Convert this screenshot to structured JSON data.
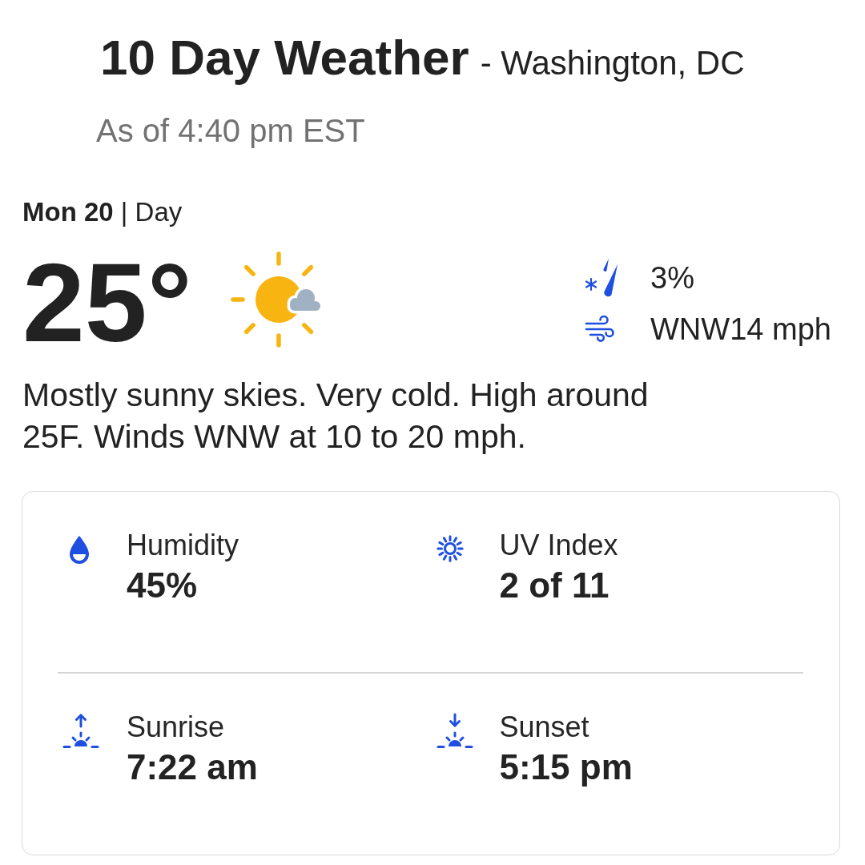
{
  "header": {
    "title": "10 Day Weather",
    "location": "- Washington, DC",
    "updated": "As of 4:40 pm EST"
  },
  "day": {
    "date_line": "**Mon 20** | Day",
    "temperature": "25°"
  },
  "conditions": [
    {
      "kind": "precipitation",
      "value": "3%"
    },
    {
      "kind": "wind",
      "value": "WNW14 mph"
    }
  ],
  "description": "Mostly sunny skies. Very cold. High around 25F. Winds WNW at 10 to 20 mph.",
  "details": [
    {
      "kind": "humidity",
      "label": "Humidity",
      "value": "45%"
    },
    {
      "kind": "uv",
      "label": "UV Index",
      "value": "2 of 11"
    },
    {
      "kind": "sunrise",
      "label": "Sunrise",
      "value": "7:22 am"
    },
    {
      "kind": "sunset",
      "label": "Sunset",
      "value": "5:15 pm"
    }
  ]
}
